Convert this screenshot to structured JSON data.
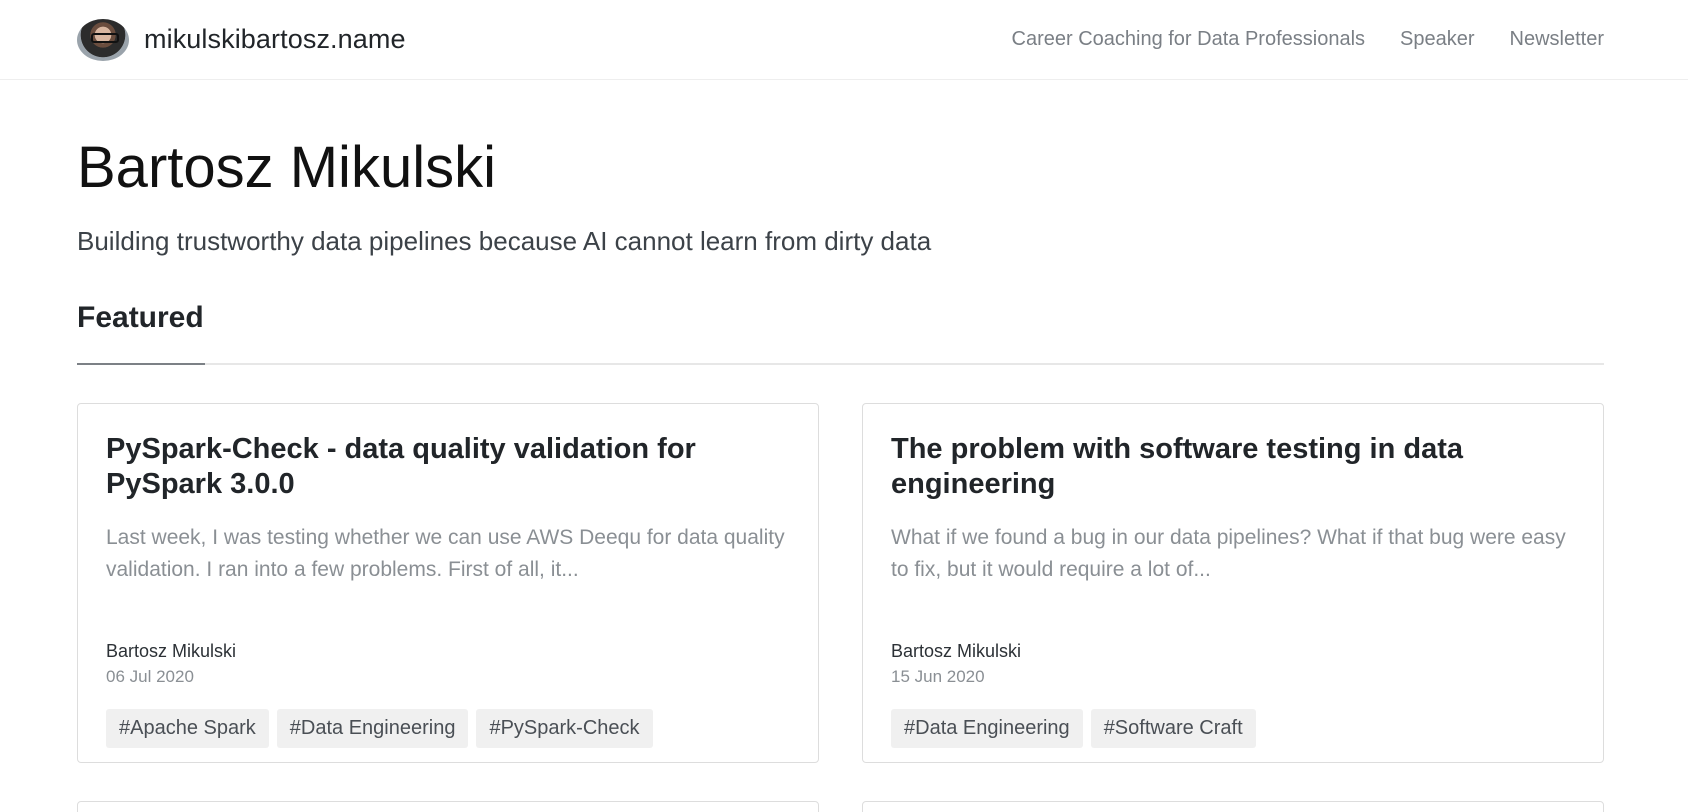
{
  "header": {
    "site_name": "mikulskibartosz.name",
    "nav": [
      {
        "label": "Career Coaching for Data Professionals"
      },
      {
        "label": "Speaker"
      },
      {
        "label": "Newsletter"
      }
    ]
  },
  "hero": {
    "title": "Bartosz Mikulski",
    "subtitle": "Building trustworthy data pipelines because AI cannot learn from dirty data"
  },
  "featured": {
    "heading": "Featured",
    "posts": [
      {
        "title": "PySpark-Check - data quality validation for PySpark 3.0.0",
        "excerpt": "Last week, I was testing whether we can use AWS Deequ for data quality validation. I ran into a few problems. First of all, it...",
        "author": "Bartosz Mikulski",
        "date": "06 Jul 2020",
        "tags": [
          "#Apache Spark",
          "#Data Engineering",
          "#PySpark-Check"
        ]
      },
      {
        "title": "The problem with software testing in data engineering",
        "excerpt": "What if we found a bug in our data pipelines? What if that bug were easy to fix, but it would require a lot of...",
        "author": "Bartosz Mikulski",
        "date": "15 Jun 2020",
        "tags": [
          "#Data Engineering",
          "#Software Craft"
        ]
      }
    ]
  }
}
